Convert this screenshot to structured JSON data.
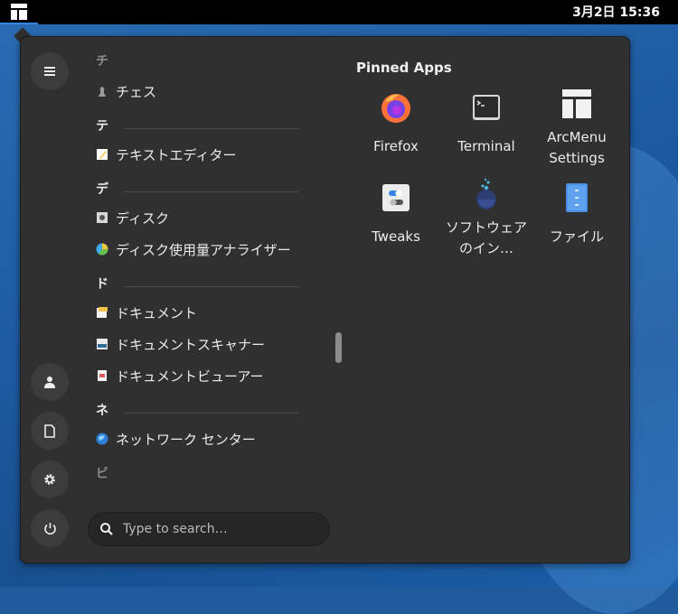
{
  "topbar": {
    "clock": "3月2日  15:36"
  },
  "menu": {
    "sidebar": {
      "top_button": "menu-icon",
      "bottom_buttons": [
        "user-icon",
        "document-icon",
        "gear-icon",
        "power-icon"
      ]
    },
    "list": {
      "headers": [
        "チ",
        "テ",
        "デ",
        "ド",
        "ネ",
        "ビ"
      ],
      "items": [
        {
          "label": "チェス",
          "icon": "chess-icon"
        },
        {
          "label": "テキストエディター",
          "icon": "text-editor-icon"
        },
        {
          "label": "ディスク",
          "icon": "disks-icon"
        },
        {
          "label": "ディスク使用量アナライザー",
          "icon": "disk-usage-icon"
        },
        {
          "label": "ドキュメント",
          "icon": "documents-icon"
        },
        {
          "label": "ドキュメントスキャナー",
          "icon": "scanner-icon"
        },
        {
          "label": "ドキュメントビューアー",
          "icon": "document-viewer-icon"
        },
        {
          "label": "ネットワーク センター",
          "icon": "network-icon"
        }
      ]
    },
    "pinned": {
      "title": "Pinned Apps",
      "apps": [
        {
          "label": "Firefox",
          "icon": "firefox-icon"
        },
        {
          "label": "Terminal",
          "icon": "terminal-icon"
        },
        {
          "label": "ArcMenu Settings",
          "icon": "arcmenu-settings-icon"
        },
        {
          "label": "Tweaks",
          "icon": "tweaks-icon"
        },
        {
          "label": "ソフトウェアのイン…",
          "icon": "software-icon"
        },
        {
          "label": "ファイル",
          "icon": "files-icon"
        }
      ]
    },
    "search": {
      "placeholder": "Type to search…"
    }
  },
  "colors": {
    "accent": "#3584e4",
    "panel": "#303030",
    "desktop": "#1f5a9c"
  }
}
